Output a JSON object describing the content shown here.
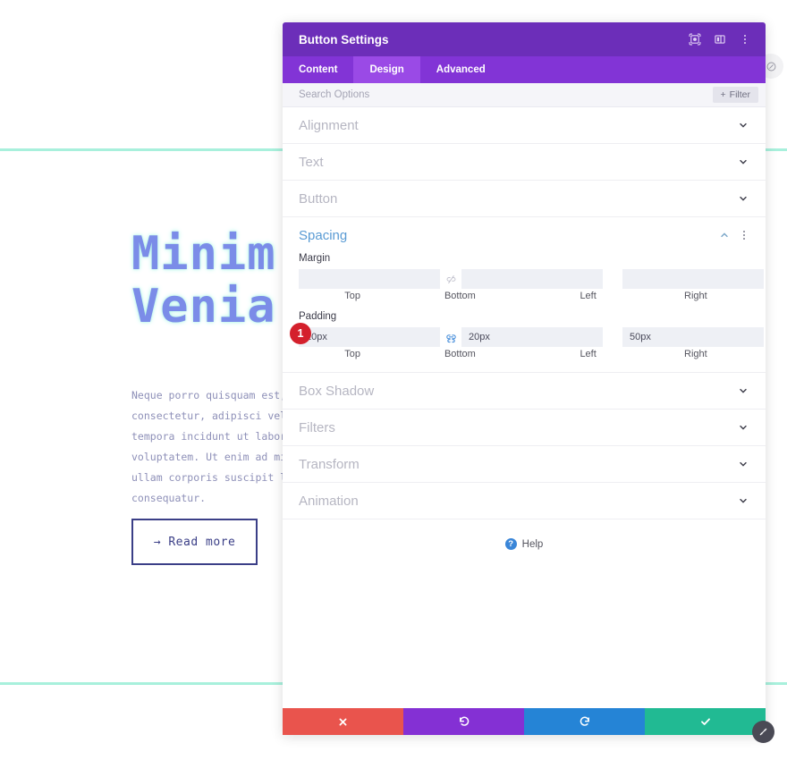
{
  "background": {
    "heading_line1": "Minim",
    "heading_line2": "Venia",
    "body_text": "Neque porro quisquam est, qu consectetur, adipisci velit, tempora incidunt ut labore e voluptatem. Ut enim ad minim ullam corporis suscipit labo consequatur.",
    "button_label": "→ Read more",
    "accent_rule_color": "#a8f0dc",
    "heading_color": "#7b8ce8",
    "button_border_color": "#3b3f87"
  },
  "modal": {
    "title": "Button Settings",
    "header_icons": [
      {
        "name": "responsive-preview-icon"
      },
      {
        "name": "layout-columns-icon"
      },
      {
        "name": "more-vertical-icon"
      }
    ],
    "tabs": [
      {
        "label": "Content",
        "active": false
      },
      {
        "label": "Design",
        "active": true
      },
      {
        "label": "Advanced",
        "active": false
      }
    ],
    "search": {
      "placeholder": "Search Options",
      "value": ""
    },
    "filter_button": {
      "label": "Filter",
      "icon": "plus-icon"
    },
    "sections": [
      {
        "title": "Alignment",
        "open": false
      },
      {
        "title": "Text",
        "open": false
      },
      {
        "title": "Button",
        "open": false
      },
      {
        "title": "Spacing",
        "open": true
      },
      {
        "title": "Box Shadow",
        "open": false
      },
      {
        "title": "Filters",
        "open": false
      },
      {
        "title": "Transform",
        "open": false
      },
      {
        "title": "Animation",
        "open": false
      }
    ],
    "spacing": {
      "margin": {
        "label": "Margin",
        "link_state": "unlinked",
        "top": {
          "value": "",
          "placeholder": "",
          "caption": "Top"
        },
        "bottom": {
          "value": "",
          "placeholder": "",
          "caption": "Bottom"
        },
        "left": {
          "value": "",
          "placeholder": "",
          "caption": "Left"
        },
        "right": {
          "value": "",
          "placeholder": "",
          "caption": "Right"
        }
      },
      "padding": {
        "label": "Padding",
        "link_state": "linked",
        "badge": "1",
        "top": {
          "value": "20px",
          "caption": "Top"
        },
        "bottom": {
          "value": "20px",
          "caption": "Bottom"
        },
        "left": {
          "value": "50px",
          "caption": "Left"
        },
        "right": {
          "value": "50px",
          "caption": "Right"
        }
      }
    },
    "help": {
      "label": "Help",
      "icon": "question-mark-icon"
    },
    "footer_buttons": [
      {
        "name": "cancel-button",
        "icon": "close-icon",
        "color": "#e9544d"
      },
      {
        "name": "undo-button",
        "icon": "undo-icon",
        "color": "#8430d4"
      },
      {
        "name": "redo-button",
        "icon": "redo-icon",
        "color": "#2584d6"
      },
      {
        "name": "save-button",
        "icon": "check-icon",
        "color": "#21ba93"
      }
    ],
    "colors": {
      "header_purple": "#6c2eb9",
      "tabbar_purple": "#8234d6",
      "active_tab_purple": "#9a4ae6",
      "open_section_blue": "#5a9bd4",
      "badge_red": "#d4202c"
    }
  }
}
